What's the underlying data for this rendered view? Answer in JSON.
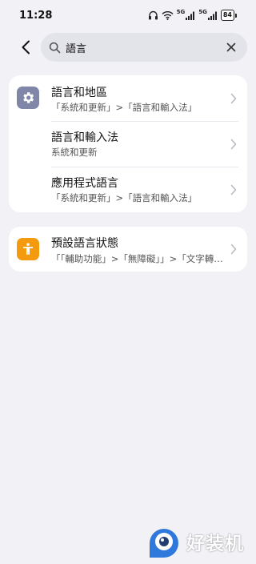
{
  "status_bar": {
    "time": "11:28",
    "battery": "84",
    "net_label_1": "5G",
    "net_label_2": "5G"
  },
  "search": {
    "query": "語言",
    "icons": {
      "back": "back-arrow-icon",
      "search": "search-icon",
      "clear": "close-icon"
    }
  },
  "results": [
    {
      "title": "語言和地區",
      "path": "「系統和更新」>「語言和輸入法」",
      "icon": "gear-icon",
      "icon_color": "#7f86a8"
    },
    {
      "title": "語言和輸入法",
      "path": "系統和更新"
    },
    {
      "title": "應用程式語言",
      "path": "「系統和更新」>「語言和輸入法」"
    },
    {
      "title": "預設語言狀態",
      "path": "「「輔助功能」>「無障礙」」>「文字轉換...",
      "icon": "accessibility-icon",
      "icon_color": "#f39a0f"
    }
  ],
  "watermark": {
    "text": "好装机"
  },
  "colors": {
    "background": "#f1f1f6",
    "card": "#ffffff",
    "search_box": "#e3e3ea",
    "settings_icon": "#7f86a8",
    "accessibility_icon": "#f39a0f"
  }
}
